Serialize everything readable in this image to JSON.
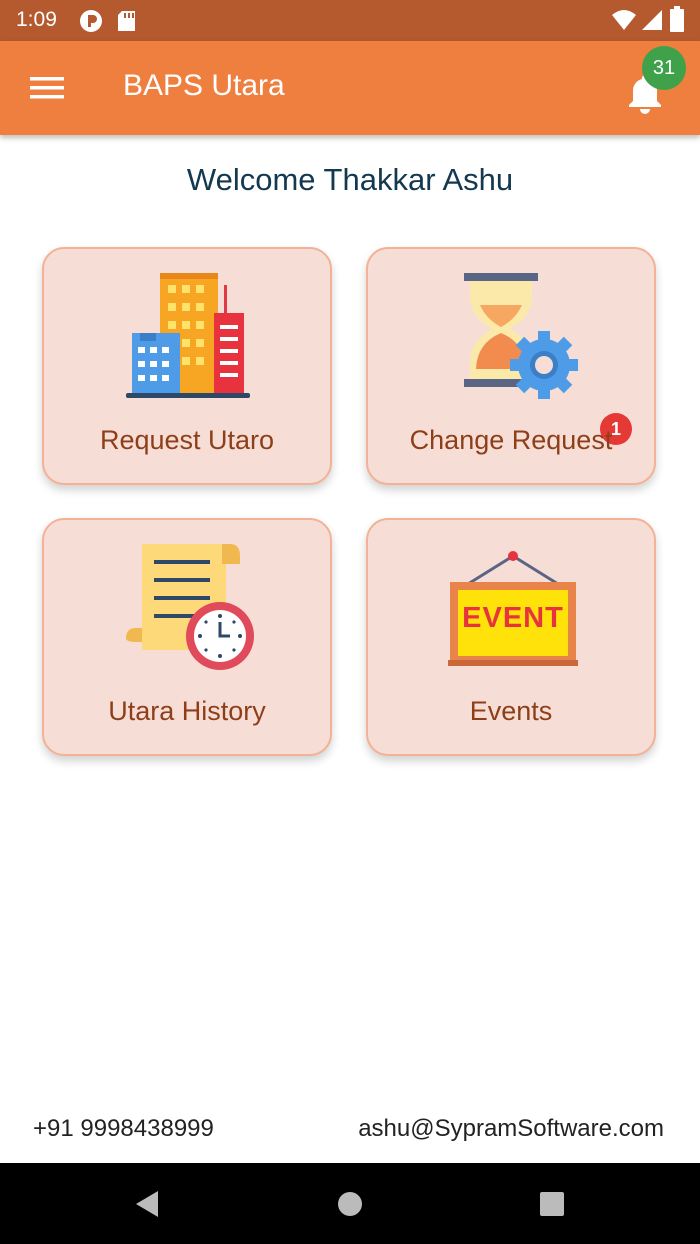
{
  "status_bar": {
    "time": "1:09"
  },
  "app_bar": {
    "title": "BAPS Utara",
    "notification_count": "31"
  },
  "welcome": "Welcome Thakkar Ashu",
  "cards": [
    {
      "label": "Request Utaro",
      "icon": "buildings-icon"
    },
    {
      "label": "Change Request",
      "icon": "hourglass-gear-icon",
      "badge": "1"
    },
    {
      "label": "Utara History",
      "icon": "document-clock-icon"
    },
    {
      "label": "Events",
      "icon": "event-sign-icon",
      "sign_text": "EVENT"
    }
  ],
  "footer": {
    "phone": "+91 9998438999",
    "email": "ashu@SypramSoftware.com"
  },
  "colors": {
    "status_bar": "#B5592E",
    "app_bar": "#EE7F3F",
    "card_bg": "#F6DED6",
    "card_label": "#8E3F1A",
    "notification_badge": "#3FA24A",
    "alert_badge": "#E53935"
  }
}
